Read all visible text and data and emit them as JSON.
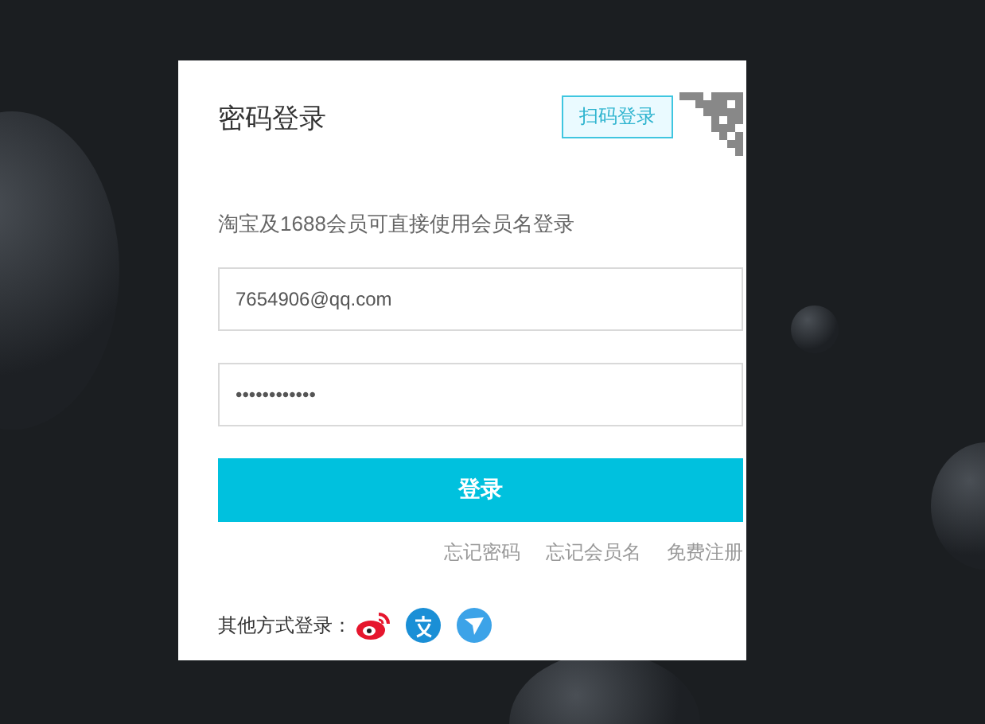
{
  "login_panel": {
    "title": "密码登录",
    "qr_login_tip": "扫码登录",
    "subtitle": "淘宝及1688会员可直接使用会员名登录",
    "username_field": {
      "value": "7654906@qq.com"
    },
    "password_field": {
      "value": "••••••••••••"
    },
    "login_button": "登录",
    "links": [
      "忘记密码",
      "忘记会员名",
      "免费注册"
    ],
    "other_login": {
      "label": "其他方式登录：",
      "options": [
        {
          "kind": "weibo"
        },
        {
          "kind": "alipay"
        },
        {
          "kind": "plane"
        }
      ]
    }
  }
}
